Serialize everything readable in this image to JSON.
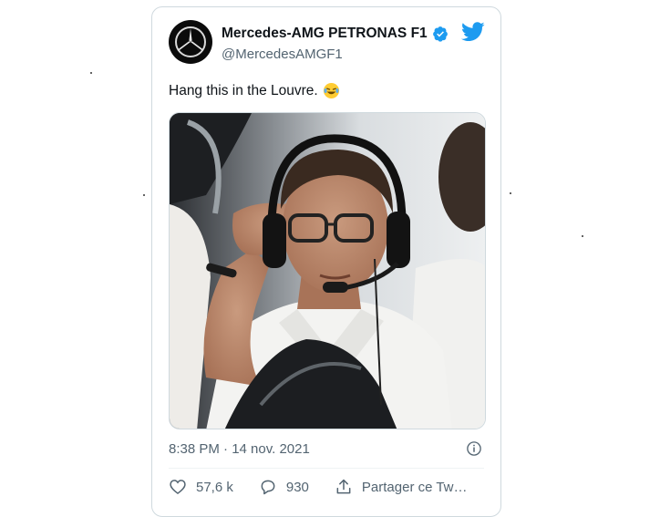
{
  "tweet": {
    "author_name": "Mercedes-AMG PETRONAS F1",
    "author_handle": "@MercedesAMGF1",
    "text": "Hang this in the Louvre.",
    "timestamp": "8:38 PM · 14 nov. 2021"
  },
  "actions": {
    "likes": "57,6 k",
    "replies": "930",
    "share_label": "Partager ce Tw…"
  },
  "icons": {
    "verified": "verified-badge-icon",
    "brand": "twitter-bird-icon",
    "emoji": "laughing-tears-emoji",
    "info": "info-icon",
    "like": "heart-icon",
    "reply": "speech-bubble-icon",
    "share": "share-upload-icon"
  },
  "colors": {
    "twitter_blue": "#1d9bf0",
    "secondary_text": "#536471",
    "border": "#cfd9de"
  }
}
